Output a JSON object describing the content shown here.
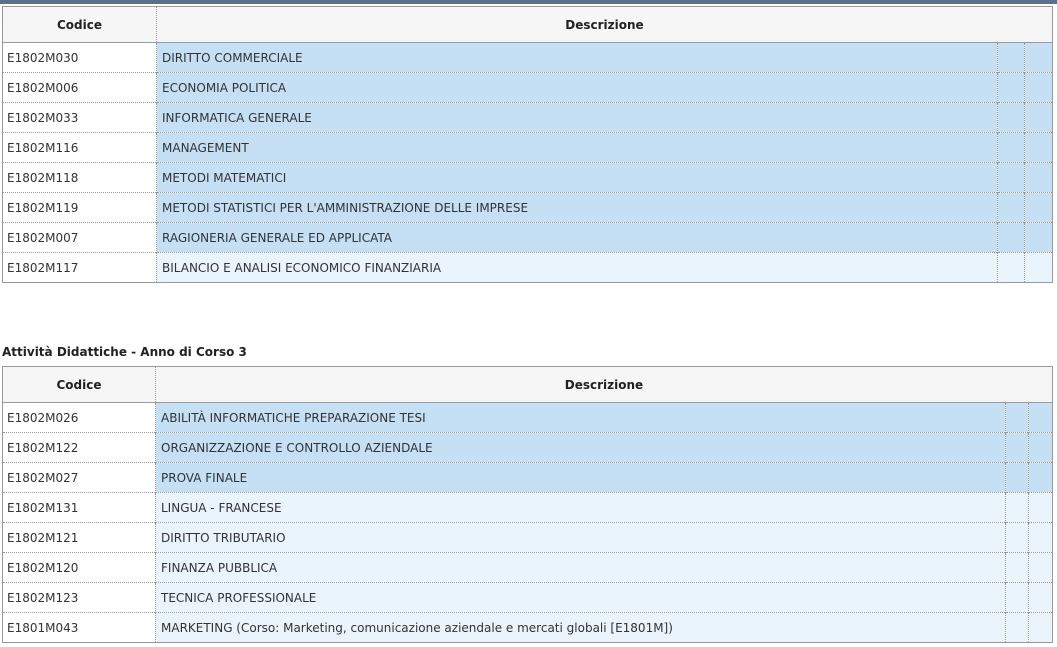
{
  "table1": {
    "headers": {
      "code": "Codice",
      "desc": "Descrizione"
    },
    "rows": [
      {
        "code": "E1802M030",
        "desc": "DIRITTO COMMERCIALE",
        "selected": true
      },
      {
        "code": "E1802M006",
        "desc": "ECONOMIA POLITICA",
        "selected": true
      },
      {
        "code": "E1802M033",
        "desc": "INFORMATICA GENERALE",
        "selected": true
      },
      {
        "code": "E1802M116",
        "desc": "MANAGEMENT",
        "selected": true
      },
      {
        "code": "E1802M118",
        "desc": "METODI MATEMATICI",
        "selected": true
      },
      {
        "code": "E1802M119",
        "desc": "METODI STATISTICI PER L'AMMINISTRAZIONE DELLE IMPRESE",
        "selected": true
      },
      {
        "code": "E1802M007",
        "desc": "RAGIONERIA GENERALE ED APPLICATA",
        "selected": true
      },
      {
        "code": "E1802M117",
        "desc": "BILANCIO E ANALISI ECONOMICO FINANZIARIA",
        "selected": false
      }
    ]
  },
  "section2_title": "Attività Didattiche - Anno di Corso 3",
  "table2": {
    "headers": {
      "code": "Codice",
      "desc": "Descrizione"
    },
    "rows": [
      {
        "code": "E1802M026",
        "desc": "ABILITÀ INFORMATICHE PREPARAZIONE TESI",
        "selected": true
      },
      {
        "code": "E1802M122",
        "desc": "ORGANIZZAZIONE E CONTROLLO AZIENDALE",
        "selected": true
      },
      {
        "code": "E1802M027",
        "desc": "PROVA FINALE",
        "selected": true
      },
      {
        "code": "E1802M131",
        "desc": "LINGUA - FRANCESE",
        "selected": false
      },
      {
        "code": "E1802M121",
        "desc": "DIRITTO TRIBUTARIO",
        "selected": false
      },
      {
        "code": "E1802M120",
        "desc": "FINANZA PUBBLICA",
        "selected": false
      },
      {
        "code": "E1802M123",
        "desc": "TECNICA PROFESSIONALE",
        "selected": false
      },
      {
        "code": "E1801M043",
        "desc": "MARKETING (Corso: Marketing, comunicazione aziendale e mercati globali [E1801M])",
        "selected": false
      }
    ]
  },
  "colors": {
    "selected": "#c5e0f5",
    "unselected": "#eaf4fd",
    "header": "#f6f6f6"
  }
}
